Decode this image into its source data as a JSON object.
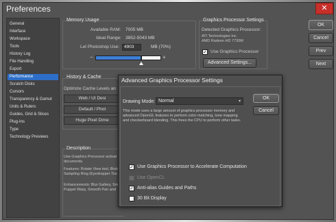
{
  "window": {
    "title": "Preferences",
    "close_label": "✕"
  },
  "sidebar": {
    "items": [
      {
        "label": "General"
      },
      {
        "label": "Interface"
      },
      {
        "label": "Workspace"
      },
      {
        "label": "Tools"
      },
      {
        "label": "History Log"
      },
      {
        "label": "File Handling"
      },
      {
        "label": "Export"
      },
      {
        "label": "Performance",
        "selected": true
      },
      {
        "label": "Scratch Disks"
      },
      {
        "label": "Cursors"
      },
      {
        "label": "Transparency & Gamut"
      },
      {
        "label": "Units & Rulers"
      },
      {
        "label": "Guides, Grid & Slices"
      },
      {
        "label": "Plug-Ins"
      },
      {
        "label": "Type"
      },
      {
        "label": "Technology Previews"
      }
    ]
  },
  "memory": {
    "title": "Memory Usage",
    "available_label": "Available RAM:",
    "available_value": "7005 MB",
    "ideal_label": "Ideal Range:",
    "ideal_value": "3852-5043 MB",
    "let_label": "Let Photoshop Use:",
    "let_value": "4903",
    "let_unit": "MB (70%)",
    "slider_level": 0.7,
    "minus": "−",
    "plus": "+"
  },
  "gpu": {
    "title": "Graphics Processor Settings",
    "detected_label": "Detected Graphics Processor:",
    "vendor": "ATI Technologies Inc.",
    "model": "AMD Radeon HD 7730M",
    "use_gpu_label": "Use Graphics Processor",
    "use_gpu_checked": true,
    "advanced_button": "Advanced Settings..."
  },
  "history_cache": {
    "title": "History & Cache",
    "optimize_label": "Optimize Cache Levels an",
    "btn_web": "Web / UI Desi",
    "btn_default": "Default / Phot",
    "btn_huge": "Huge Pixel Dime"
  },
  "description": {
    "title": "Description",
    "p1": "Use Graphics Processor activat documents.",
    "p2": "Features: Rotate View tool, Birds Sampling Ring (Eyedropper Too",
    "p3": "Enhancements: Blur Gallery, Sma Puppet Warp, Smooth Pan and"
  },
  "right_buttons": {
    "ok": "OK",
    "cancel": "Cancel",
    "prev": "Prev",
    "next": "Next"
  },
  "dialog": {
    "title": "Advanced Graphics Processor Settings",
    "mode_label": "Drawing Mode:",
    "mode_value": "Normal",
    "mode_description": "This mode uses a large amount of graphics processor memory and advanced OpenGL features to perform color matching, tone mapping and checkerboard blending. This frees the CPU to perform other tasks.",
    "ok": "OK",
    "cancel": "Cancel",
    "options": [
      {
        "label": "Use Graphics Processor to Accelerate Computation",
        "checked": true,
        "disabled": false
      },
      {
        "label": "Use OpenCL",
        "checked": false,
        "disabled": true
      },
      {
        "label": "Anti-alias Guides and Paths",
        "checked": true,
        "disabled": false
      },
      {
        "label": "30 Bit Display",
        "checked": false,
        "disabled": false
      }
    ]
  }
}
